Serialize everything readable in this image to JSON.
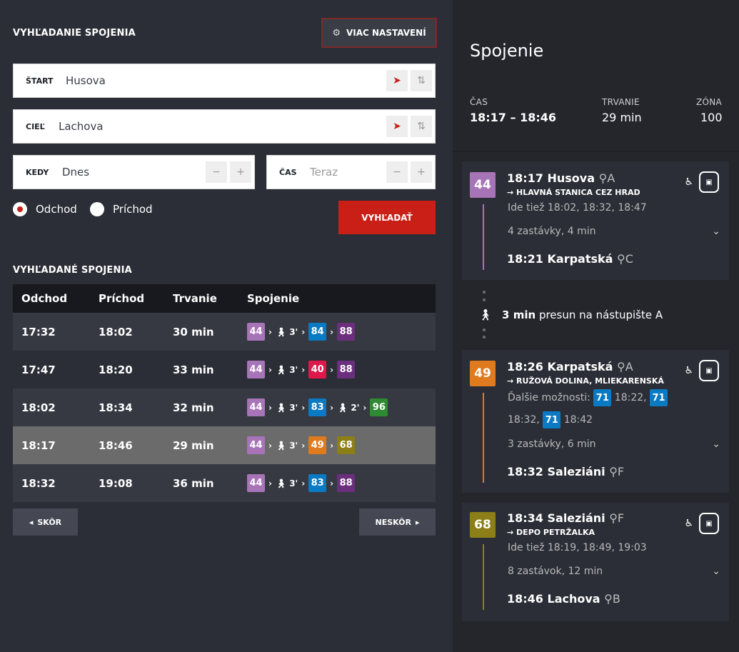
{
  "search": {
    "title": "VYHĽADANIE SPOJENIA",
    "more_settings": "VIAC NASTAVENÍ",
    "start_label": "ŠTART",
    "start_value": "Husova",
    "dest_label": "CIEĽ",
    "dest_value": "Lachova",
    "when_label": "KEDY",
    "when_value": "Dnes",
    "time_label": "ČAS",
    "time_placeholder": "Teraz",
    "minus": "−",
    "plus": "+",
    "departure": "Odchod",
    "arrival": "Príchod",
    "search_button": "VYHĽADAŤ"
  },
  "results": {
    "title": "VYHĽADANÉ SPOJENIA",
    "headers": [
      "Odchod",
      "Príchod",
      "Trvanie",
      "Spojenie"
    ],
    "rows": [
      {
        "dep": "17:32",
        "arr": "18:02",
        "dur": "30 min"
      },
      {
        "dep": "17:47",
        "arr": "18:20",
        "dur": "33 min"
      },
      {
        "dep": "18:02",
        "arr": "18:34",
        "dur": "32 min"
      },
      {
        "dep": "18:17",
        "arr": "18:46",
        "dur": "29 min"
      },
      {
        "dep": "18:32",
        "arr": "19:08",
        "dur": "36 min"
      }
    ],
    "walk_3": "3'",
    "walk_2": "2'",
    "earlier": "SKÔR",
    "later": "NESKÔR"
  },
  "lines": {
    "l44": "44",
    "l84": "84",
    "l88": "88",
    "l40": "40",
    "l83": "83",
    "l96": "96",
    "l49": "49",
    "l68": "68",
    "l71": "71"
  },
  "colors": {
    "c44": "#a874b8",
    "c84": "#0a7ac3",
    "c88": "#6b2f7e",
    "c40": "#e0174a",
    "c83": "#0a7ac3",
    "c96": "#2e8b32",
    "c49": "#e07a1f",
    "c68": "#8c7f18",
    "accent": "#c91f16"
  },
  "detail": {
    "title": "Spojenie",
    "time_label": "ČAS",
    "time_value": "18:17 – 18:46",
    "duration_label": "TRVANIE",
    "duration_value": "29 min",
    "zone_label": "ZÓNA",
    "zone_value": "100",
    "leg1": {
      "stop_from": "18:17 Husova",
      "plat_from": "A",
      "dir": "→ HLAVNÁ STANICA CEZ HRAD",
      "also": "Ide tiež 18:02, 18:32, 18:47",
      "stops": "4 zastávky, 4 min",
      "stop_to": "18:21 Karpatská",
      "plat_to": "C"
    },
    "transfer": {
      "bold": "3 min",
      "text": "presun na nástupište A"
    },
    "leg2": {
      "stop_from": "18:26 Karpatská",
      "plat_from": "A",
      "dir": "→ RUŽOVÁ DOLINA, MLIEKARENSKÁ",
      "more_label": "Ďalšie možnosti:",
      "t1": "18:22,",
      "t2": "18:32,",
      "t3": "18:42",
      "stops": "3 zastávky, 6 min",
      "stop_to": "18:32 Saleziáni",
      "plat_to": "F"
    },
    "leg3": {
      "stop_from": "18:34 Saleziáni",
      "plat_from": "F",
      "dir": "→ DEPO PETRŽALKA",
      "also": "Ide tiež 18:19, 18:49, 19:03",
      "stops": "8 zastávok, 12 min",
      "stop_to": "18:46 Lachova",
      "plat_to": "B"
    }
  }
}
